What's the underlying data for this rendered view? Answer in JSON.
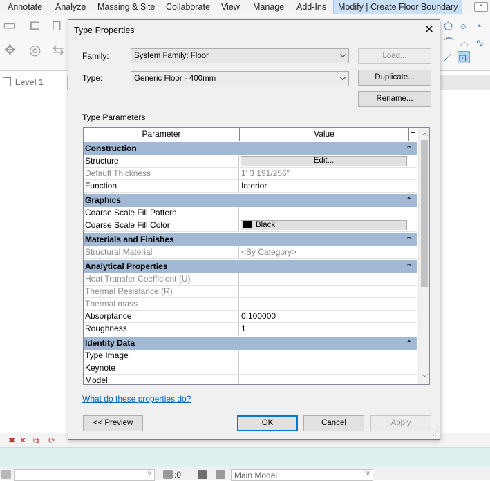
{
  "app": {
    "ribbon_tabs": [
      {
        "label": "Annotate"
      },
      {
        "label": "Analyze"
      },
      {
        "label": "Massing & Site"
      },
      {
        "label": "Collaborate"
      },
      {
        "label": "View"
      },
      {
        "label": "Manage"
      },
      {
        "label": "Add-Ins"
      },
      {
        "label": "Modify | Create Floor Boundary"
      }
    ],
    "view_tab": {
      "title": "Level 1"
    },
    "status_bar": {
      "workset_value": ":0",
      "model_label": "Main Model"
    }
  },
  "dialog": {
    "title": "Type Properties",
    "family_label": "Family:",
    "family_value": "System Family: Floor",
    "type_label": "Type:",
    "type_value": "Generic Floor - 400mm",
    "load_button": "Load...",
    "duplicate_button": "Duplicate...",
    "rename_button": "Rename...",
    "type_parameters_label": "Type Parameters",
    "grid": {
      "header_parameter": "Parameter",
      "header_value": "Value",
      "header_extra": "=",
      "groups": [
        {
          "name": "Construction",
          "rows": [
            {
              "param": "Structure",
              "value": "Edit...",
              "kind": "button"
            },
            {
              "param": "Default Thickness",
              "value": "1'  3 191/256\"",
              "dim": true
            },
            {
              "param": "Function",
              "value": "Interior"
            }
          ]
        },
        {
          "name": "Graphics",
          "rows": [
            {
              "param": "Coarse Scale Fill Pattern",
              "value": ""
            },
            {
              "param": "Coarse Scale Fill Color",
              "value": "Black",
              "kind": "color"
            }
          ]
        },
        {
          "name": "Materials and Finishes",
          "rows": [
            {
              "param": "Structural Material",
              "value": "<By Category>",
              "dim": true
            }
          ]
        },
        {
          "name": "Analytical Properties",
          "rows": [
            {
              "param": "Heat Transfer Coefficient (U)",
              "value": "",
              "dim": true
            },
            {
              "param": "Thermal Resistance (R)",
              "value": "",
              "dim": true
            },
            {
              "param": "Thermal mass",
              "value": "",
              "dim": true
            },
            {
              "param": "Absorptance",
              "value": "0.100000"
            },
            {
              "param": "Roughness",
              "value": "1"
            }
          ]
        },
        {
          "name": "Identity Data",
          "rows": [
            {
              "param": "Type Image",
              "value": ""
            },
            {
              "param": "Keynote",
              "value": ""
            },
            {
              "param": "Model",
              "value": ""
            }
          ]
        }
      ]
    },
    "help_link": "What do these properties do?",
    "preview_button": "<< Preview",
    "ok_button": "OK",
    "cancel_button": "Cancel",
    "apply_button": "Apply"
  },
  "colors": {
    "group_header": "#a1b9d4",
    "link": "#0066cc",
    "default_button_border": "#0078d7",
    "ribbon_active_tab": "#c9e0f7"
  }
}
